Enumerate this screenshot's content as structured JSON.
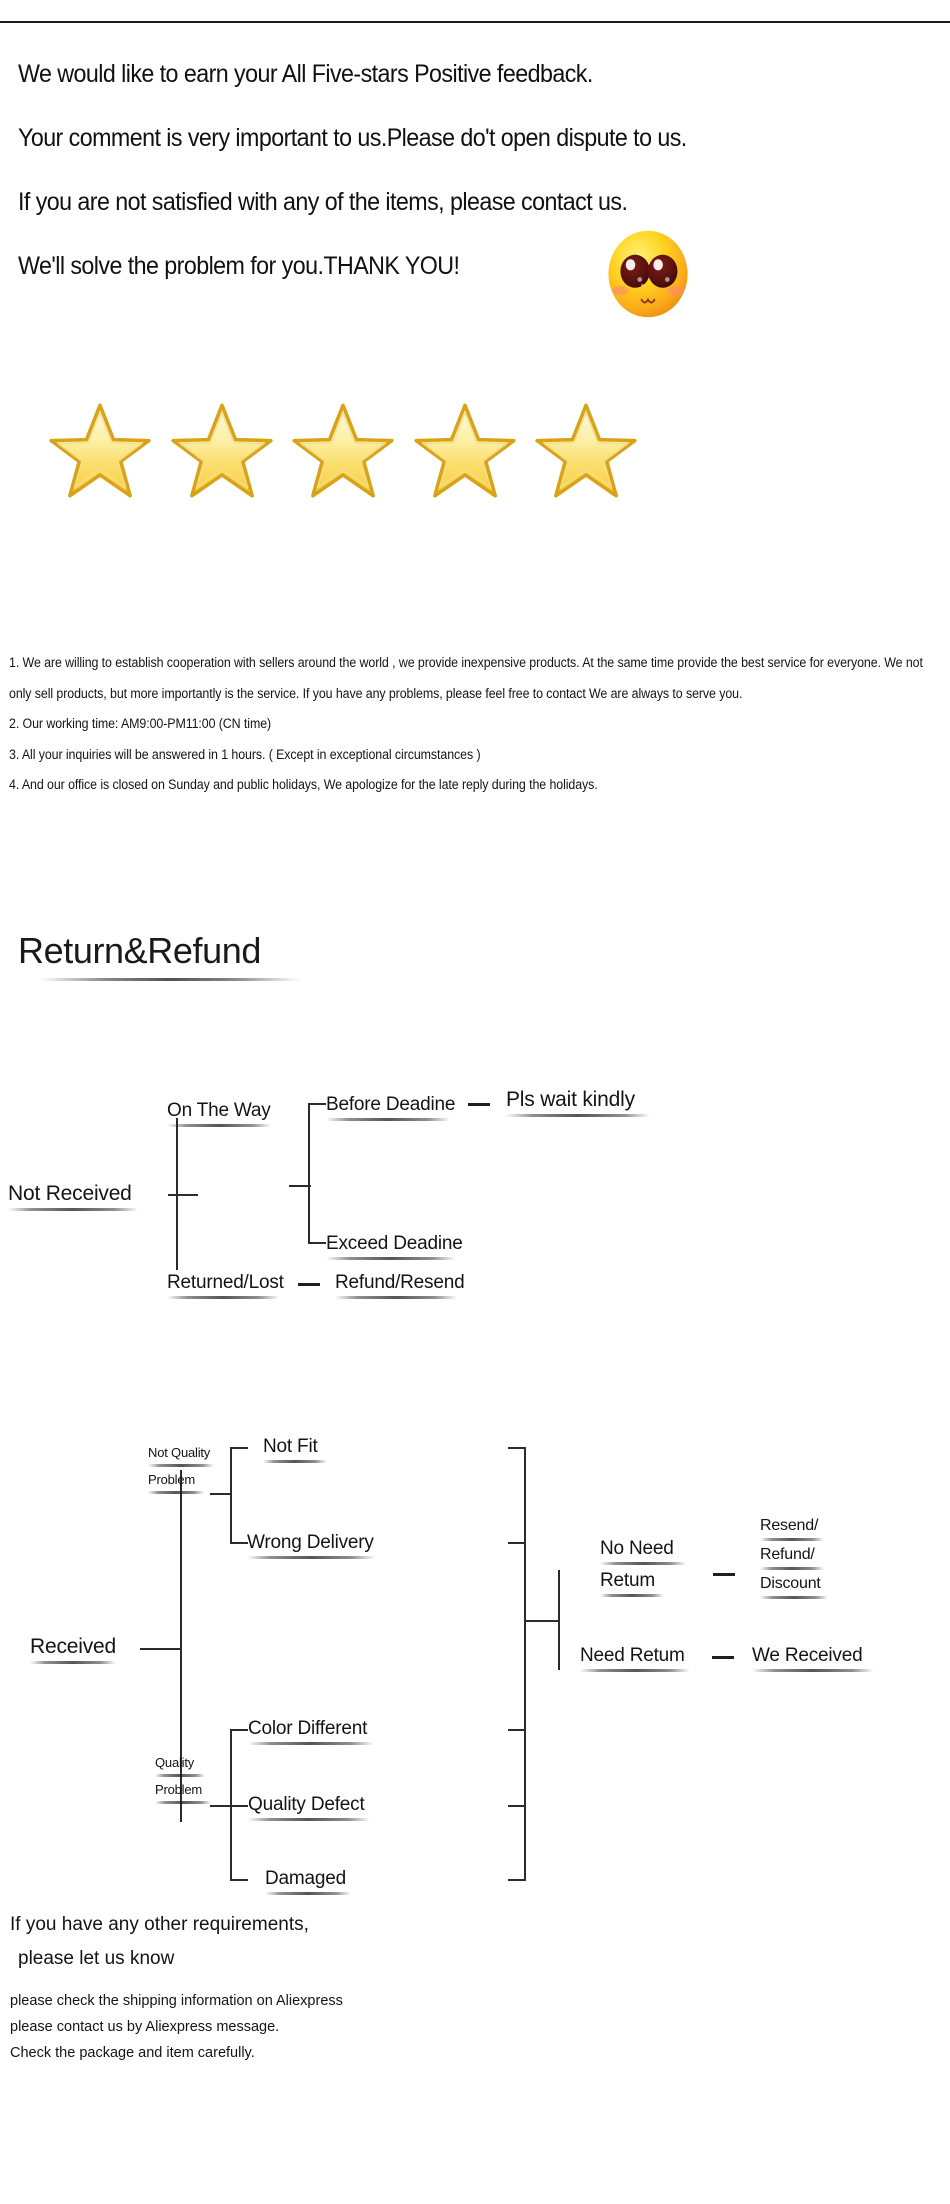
{
  "hero": {
    "lines": [
      "We would like to earn your All Five-stars Positive feedback.",
      "Your comment is very important to us.Please do't open dispute to us.",
      "If you are not satisfied with any of the items, please contact us.",
      "We'll solve the problem for you.THANK YOU!"
    ],
    "emoji_name": "starry-eyed-blushing-face-emoji"
  },
  "rating": {
    "star_count": 5,
    "star_fill": "#FBE27A",
    "star_stroke": "#D39B12"
  },
  "policy": {
    "items": [
      "1. We are willing to establish cooperation with sellers around the world , we provide inexpensive products. At the same time provide the best service for everyone. We not only sell products, but more importantly is the service. If you have any problems, please feel free to contact We are always to serve you.",
      "2. Our working time: AM9:00-PM11:00 (CN time)",
      "3. All your inquiries will be answered in 1 hours. ( Except in exceptional circumstances )",
      "4. And our office is closed on Sunday and public holidays, We apologize for the late reply during the holidays."
    ]
  },
  "return_refund": {
    "title": "Return&Refund"
  },
  "flow_not_received": {
    "root": "Not    Received",
    "on_the_way": "On The Way",
    "before_deadline": "Before Deadine",
    "exceed_deadline": "Exceed Deadine",
    "pls_wait": "Pls wait kindly",
    "returned_lost": "Returned/Lost",
    "refund_resend": "Refund/Resend"
  },
  "flow_received": {
    "root": "Received",
    "not_quality_problem_l1": "Not Quality",
    "not_quality_problem_l2": "Problem",
    "not_fit": "Not Fit",
    "wrong_delivery": "Wrong Delivery",
    "quality_problem_l1": "Quality",
    "quality_problem_l2": "Problem",
    "color_different": "Color Different",
    "quality_defect": "Quality Defect",
    "damaged": "Damaged",
    "no_need_return_l1": "No Need",
    "no_need_return_l2": "Retum",
    "resend_l1": "Resend/",
    "resend_l2": "Refund/",
    "resend_l3": "Discount",
    "need_return": "Need Retum",
    "we_received": "We Received"
  },
  "footer": {
    "headline_1": "If you have any other requirements,",
    "headline_2": "please let us know",
    "notes": [
      "please check the shipping information on Aliexpress",
      "please contact us by Aliexpress message.",
      "Check the package and item carefully."
    ]
  }
}
